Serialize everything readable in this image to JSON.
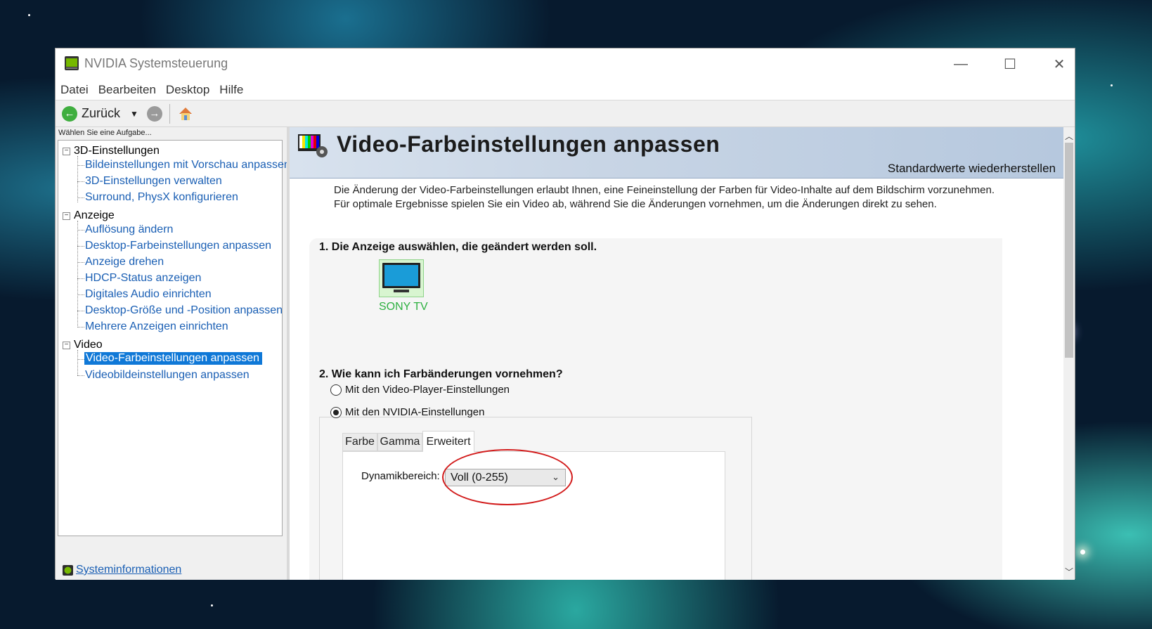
{
  "window": {
    "title": "NVIDIA Systemsteuerung",
    "controls": {
      "minimize": "—",
      "maximize": "☐",
      "close": "✕"
    }
  },
  "menu": [
    "Datei",
    "Bearbeiten",
    "Desktop",
    "Hilfe"
  ],
  "toolbar": {
    "back_label": "Zurück"
  },
  "left": {
    "task_prompt": "Wählen Sie eine Aufgabe...",
    "categories": [
      {
        "label": "3D-Einstellungen",
        "items": [
          "Bildeinstellungen mit Vorschau anpassen",
          "3D-Einstellungen verwalten",
          "Surround, PhysX konfigurieren"
        ]
      },
      {
        "label": "Anzeige",
        "items": [
          "Auflösung ändern",
          "Desktop-Farbeinstellungen anpassen",
          "Anzeige drehen",
          "HDCP-Status anzeigen",
          "Digitales Audio einrichten",
          "Desktop-Größe und -Position anpassen",
          "Mehrere Anzeigen einrichten"
        ]
      },
      {
        "label": "Video",
        "items": [
          "Video-Farbeinstellungen anpassen",
          "Videobildeinstellungen anpassen"
        ]
      }
    ],
    "selected_item": "Video-Farbeinstellungen anpassen",
    "sysinfo_link": "Systeminformationen"
  },
  "main": {
    "title": "Video-Farbeinstellungen anpassen",
    "restore_link": "Standardwerte wiederherstellen",
    "description_line1": "Die Änderung der Video-Farbeinstellungen erlaubt Ihnen, eine Feineinstellung der Farben für Video-Inhalte auf dem Bildschirm vorzunehmen.",
    "description_line2": "Für optimale Ergebnisse spielen Sie ein Video ab, während Sie die Änderungen vornehmen, um die Änderungen direkt zu sehen.",
    "section1_title": "1. Die Anzeige auswählen, die geändert werden soll.",
    "display_name": "SONY TV",
    "section2_title": "2. Wie kann ich Farbänderungen vornehmen?",
    "radio_options": [
      {
        "label": "Mit den Video-Player-Einstellungen",
        "checked": false
      },
      {
        "label": "Mit den NVIDIA-Einstellungen",
        "checked": true
      }
    ],
    "tabs": [
      "Farbe",
      "Gamma",
      "Erweitert"
    ],
    "active_tab": "Erweitert",
    "dynamic_range_label": "Dynamikbereich:",
    "dynamic_range_value": "Voll (0-255)"
  },
  "colors": {
    "link": "#1a5fb4",
    "selection": "#0f78d7",
    "display_green": "#2db040",
    "annotation_red": "#d21a1a"
  }
}
